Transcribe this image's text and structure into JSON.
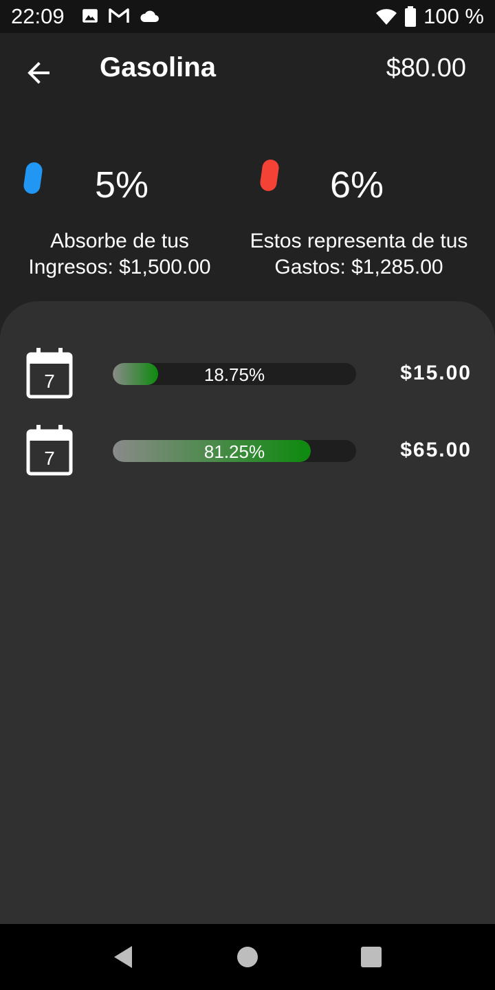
{
  "status_bar": {
    "time": "22:09",
    "battery": "100 %",
    "icons": [
      "image-icon",
      "gmail-icon",
      "cloud-icon",
      "wifi-icon",
      "battery-icon"
    ]
  },
  "header": {
    "title": "Gasolina",
    "total": "$80.00"
  },
  "stats": [
    {
      "percent": "5%",
      "desc_line1": "Absorbe de tus",
      "desc_line2": "Ingresos: $1,500.00",
      "color": "#2196f3"
    },
    {
      "percent": "6%",
      "desc_line1": "Estos representa de tus",
      "desc_line2": "Gastos: $1,285.00",
      "color": "#f44336"
    }
  ],
  "entries": [
    {
      "day": "7",
      "percent_label": "18.75%",
      "fraction": 0.1875,
      "amount": "$15.00"
    },
    {
      "day": "7",
      "percent_label": "81.25%",
      "fraction": 0.8125,
      "amount": "$65.00"
    }
  ],
  "colors": {
    "background": "#222222",
    "sheet": "#303030",
    "bar_gradient_end": "#0d8a0d"
  }
}
